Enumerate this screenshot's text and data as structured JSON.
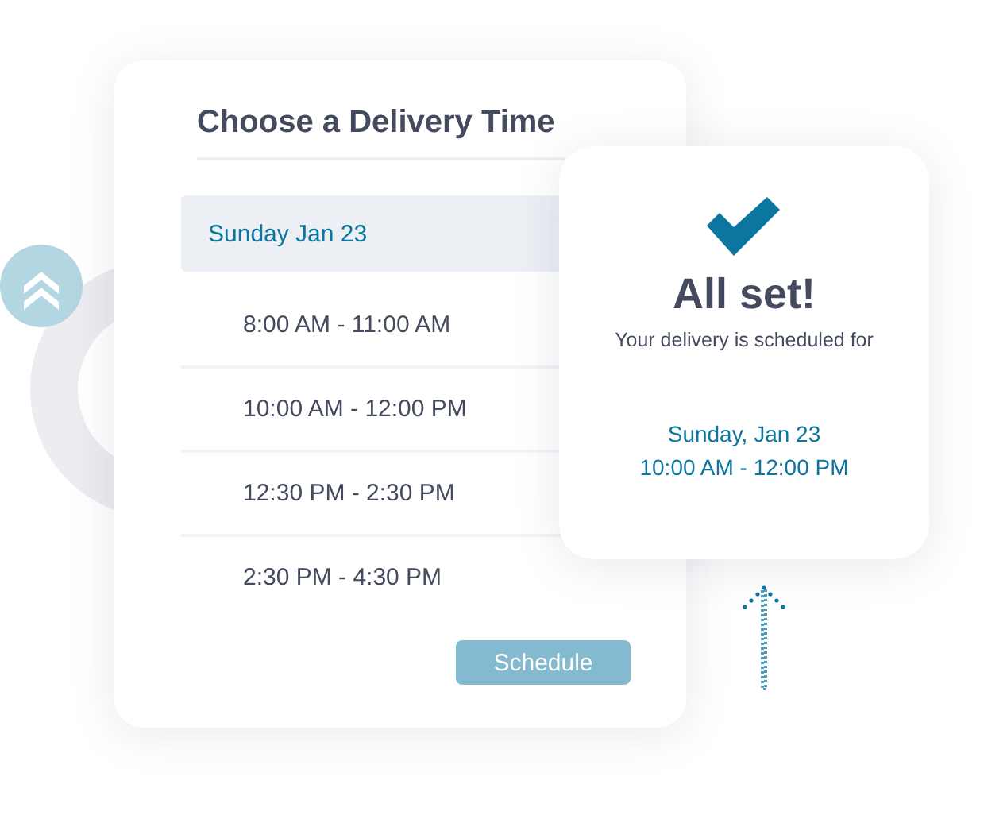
{
  "picker": {
    "title": "Choose a Delivery Time",
    "dates": [
      {
        "label": "Sunday Jan 23",
        "selected": true
      }
    ],
    "slots": [
      {
        "label": "8:00 AM - 11:00 AM"
      },
      {
        "label": "10:00 AM - 12:00 PM"
      },
      {
        "label": "12:30 PM - 2:30 PM"
      },
      {
        "label": "2:30 PM - 4:30 PM"
      }
    ],
    "button": {
      "label": "Schedule",
      "disabled": true
    }
  },
  "confirmation": {
    "title": "All set!",
    "subtitle": "Your delivery is scheduled for",
    "date": "Sunday, Jan 23",
    "time": "10:00 AM - 12:00 PM"
  }
}
